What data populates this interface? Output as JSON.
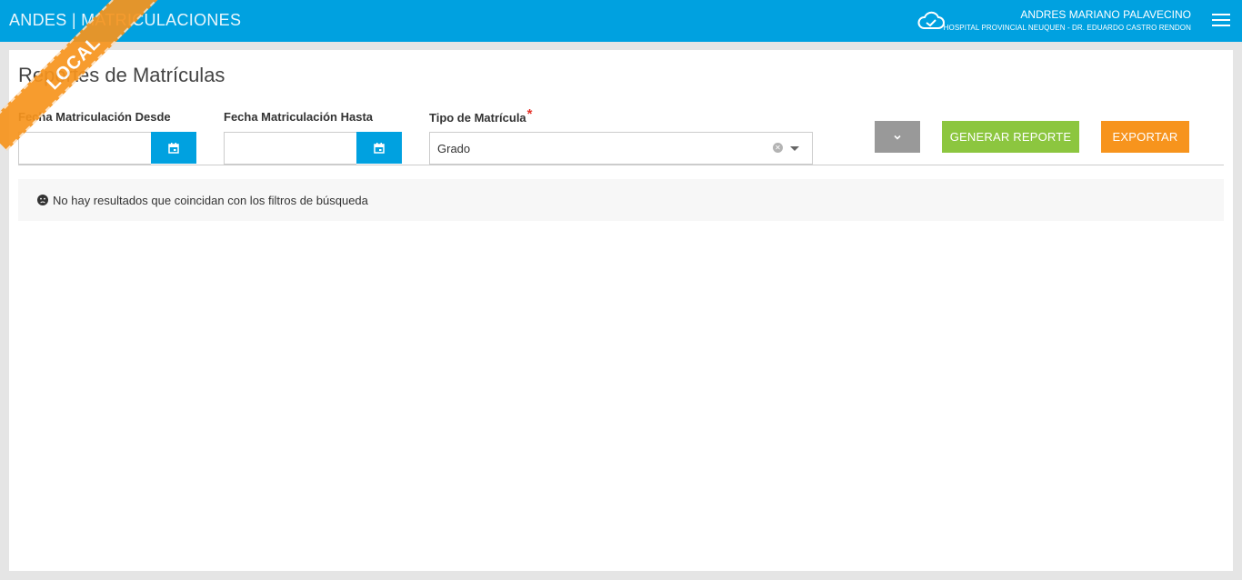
{
  "header": {
    "app_title": "ANDES | MATRICULACIONES",
    "user_name": "ANDRES MARIANO PALAVECINO",
    "user_org": "HOSPITAL PROVINCIAL NEUQUEN - DR. EDUARDO CASTRO RENDON",
    "icons": [
      "cloud-check-icon",
      "hamburger-menu-icon"
    ]
  },
  "ribbon": {
    "label": "LOCAL"
  },
  "page": {
    "title": "Reportes de Matrículas"
  },
  "filters": {
    "fecha_desde": {
      "label": "Fecha Matriculación Desde",
      "value": ""
    },
    "fecha_hasta": {
      "label": "Fecha Matriculación Hasta",
      "value": ""
    },
    "tipo": {
      "label": "Tipo de Matrícula",
      "required_mark": "*",
      "value": "Grado"
    }
  },
  "actions": {
    "generate_label": "GENERAR REPORTE",
    "export_label": "EXPORTAR"
  },
  "results": {
    "empty_message": "No hay resultados que coincidan con los filtros de búsqueda"
  },
  "colors": {
    "primary": "#00a1e0",
    "success": "#8cc63f",
    "warning": "#f7941d",
    "neutral": "#999999"
  }
}
